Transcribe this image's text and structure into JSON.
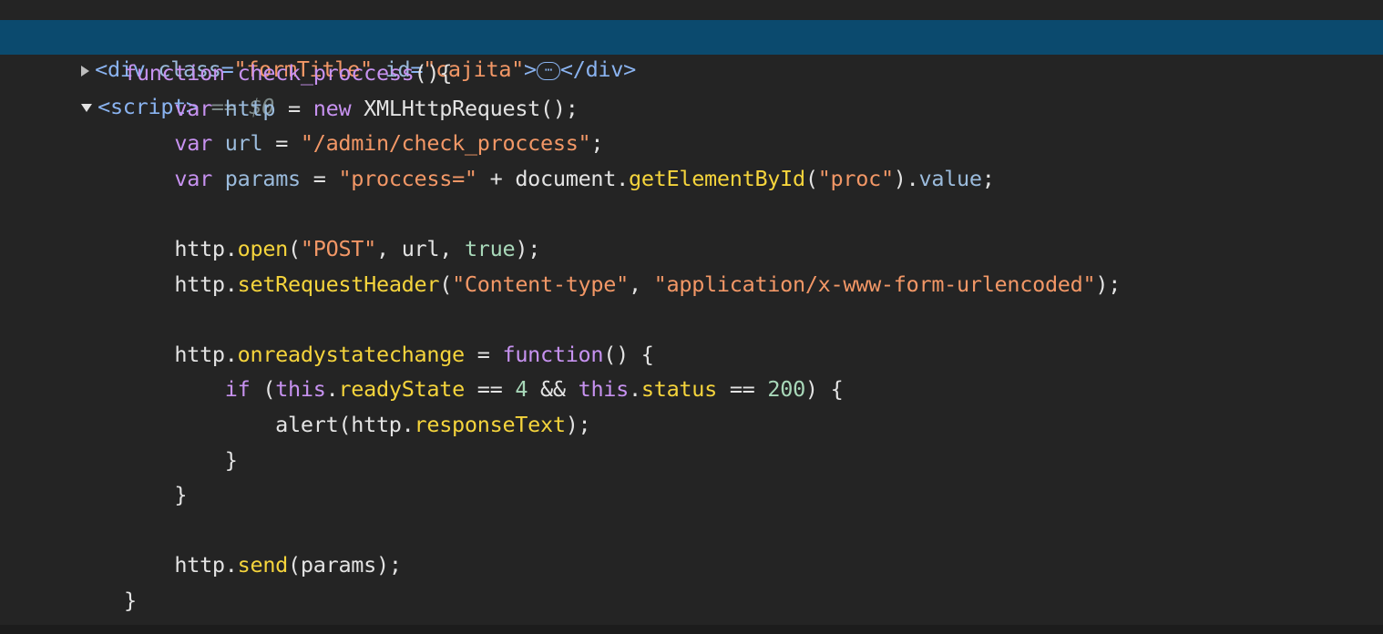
{
  "elements_row": {
    "tag_open": "<div",
    "attr1_name": "class",
    "attr1_val": "\"formTitle\"",
    "attr2_name": "id",
    "attr2_val": "\"cajita\"",
    "tag_end": ">",
    "ellipsis": "⋯",
    "close_tag": "</div>"
  },
  "selected_row": {
    "tag": "<script>",
    "marker": "== $0"
  },
  "code_lines": [
    [
      [
        "    ",
        "plain"
      ],
      [
        "function ",
        "kw"
      ],
      [
        "check_proccess",
        "fn-name"
      ],
      [
        "(){",
        "plain"
      ]
    ],
    [
      [
        "        ",
        "plain"
      ],
      [
        "var ",
        "kw"
      ],
      [
        "http",
        "prop"
      ],
      [
        " = ",
        "plain"
      ],
      [
        "new ",
        "kw"
      ],
      [
        "XMLHttpRequest",
        "plain"
      ],
      [
        "();",
        "plain"
      ]
    ],
    [
      [
        "        ",
        "plain"
      ],
      [
        "var ",
        "kw"
      ],
      [
        "url",
        "prop"
      ],
      [
        " = ",
        "plain"
      ],
      [
        "\"/admin/check_proccess\"",
        "str"
      ],
      [
        ";",
        "plain"
      ]
    ],
    [
      [
        "        ",
        "plain"
      ],
      [
        "var ",
        "kw"
      ],
      [
        "params",
        "prop"
      ],
      [
        " = ",
        "plain"
      ],
      [
        "\"proccess=\"",
        "str"
      ],
      [
        " + document.",
        "plain"
      ],
      [
        "getElementById",
        "mth"
      ],
      [
        "(",
        "plain"
      ],
      [
        "\"proc\"",
        "str"
      ],
      [
        ").",
        "plain"
      ],
      [
        "value",
        "prop"
      ],
      [
        ";",
        "plain"
      ]
    ],
    [
      [
        "",
        "plain"
      ]
    ],
    [
      [
        "        ",
        "plain"
      ],
      [
        "http.",
        "plain"
      ],
      [
        "open",
        "mth"
      ],
      [
        "(",
        "plain"
      ],
      [
        "\"POST\"",
        "str"
      ],
      [
        ", url, ",
        "plain"
      ],
      [
        "true",
        "lit"
      ],
      [
        ");",
        "plain"
      ]
    ],
    [
      [
        "        ",
        "plain"
      ],
      [
        "http.",
        "plain"
      ],
      [
        "setRequestHeader",
        "mth"
      ],
      [
        "(",
        "plain"
      ],
      [
        "\"Content-type\"",
        "str"
      ],
      [
        ", ",
        "plain"
      ],
      [
        "\"application/x-www-form-urlencoded\"",
        "str"
      ],
      [
        ");",
        "plain"
      ]
    ],
    [
      [
        "",
        "plain"
      ]
    ],
    [
      [
        "        ",
        "plain"
      ],
      [
        "http.",
        "plain"
      ],
      [
        "onreadystatechange",
        "mth"
      ],
      [
        " = ",
        "plain"
      ],
      [
        "function",
        "kw"
      ],
      [
        "() {",
        "plain"
      ]
    ],
    [
      [
        "            ",
        "plain"
      ],
      [
        "if ",
        "kw"
      ],
      [
        "(",
        "plain"
      ],
      [
        "this",
        "kw"
      ],
      [
        ".",
        "plain"
      ],
      [
        "readyState",
        "mth"
      ],
      [
        " == ",
        "plain"
      ],
      [
        "4",
        "lit"
      ],
      [
        " && ",
        "plain"
      ],
      [
        "this",
        "kw"
      ],
      [
        ".",
        "plain"
      ],
      [
        "status",
        "mth"
      ],
      [
        " == ",
        "plain"
      ],
      [
        "200",
        "lit"
      ],
      [
        ") {",
        "plain"
      ]
    ],
    [
      [
        "                ",
        "plain"
      ],
      [
        "alert(http.",
        "plain"
      ],
      [
        "responseText",
        "mth"
      ],
      [
        ");",
        "plain"
      ]
    ],
    [
      [
        "            ",
        "plain"
      ],
      [
        "}",
        "plain"
      ]
    ],
    [
      [
        "        ",
        "plain"
      ],
      [
        "}",
        "plain"
      ]
    ],
    [
      [
        "",
        "plain"
      ]
    ],
    [
      [
        "        ",
        "plain"
      ],
      [
        "http.",
        "plain"
      ],
      [
        "send",
        "mth"
      ],
      [
        "(params);",
        "plain"
      ]
    ],
    [
      [
        "    ",
        "plain"
      ],
      [
        "}",
        "plain"
      ]
    ]
  ],
  "colors": {
    "background": "#242424",
    "selection": "#0b4a6e",
    "keyword": "#c792f0",
    "string": "#f29766",
    "method": "#f5d43c",
    "property": "#9bbbdc",
    "literal": "#a8d8b9"
  }
}
